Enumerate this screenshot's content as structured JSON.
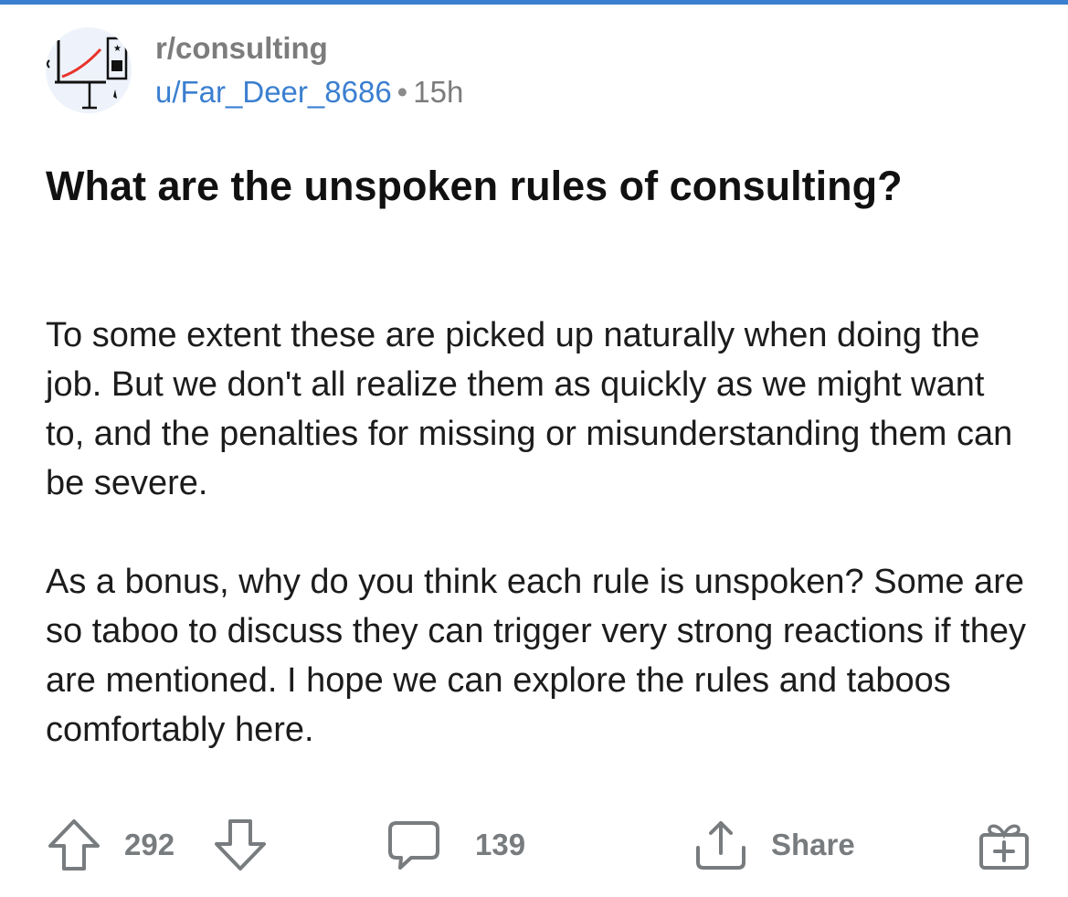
{
  "post": {
    "subreddit": "r/consulting",
    "author": "u/Far_Deer_8686",
    "separator": "•",
    "age": "15h",
    "title": "What are the unspoken rules of consulting?",
    "paragraphs": [
      "To some extent these are picked up naturally when doing the job. But we don't all realize them as quickly as we might want to, and the penalties for missing or misunderstanding them can be severe.",
      "As a bonus, why do you think each rule is unspoken? Some are so taboo to discuss they can trigger very strong reactions if they are mentioned. I hope we can explore the rules and taboos comfortably here."
    ]
  },
  "actions": {
    "upvote_icon": "arrow-up-icon",
    "score": "292",
    "downvote_icon": "arrow-down-icon",
    "comment_icon": "speech-bubble-icon",
    "comments": "139",
    "share_icon": "share-tray-icon",
    "share_label": "Share",
    "award_icon": "gift-box-icon"
  },
  "colors": {
    "accent_blue": "#3b7fd0",
    "meta_gray": "#7c7c7c",
    "action_gray": "#787c7e",
    "text": "#1a1a1b"
  }
}
